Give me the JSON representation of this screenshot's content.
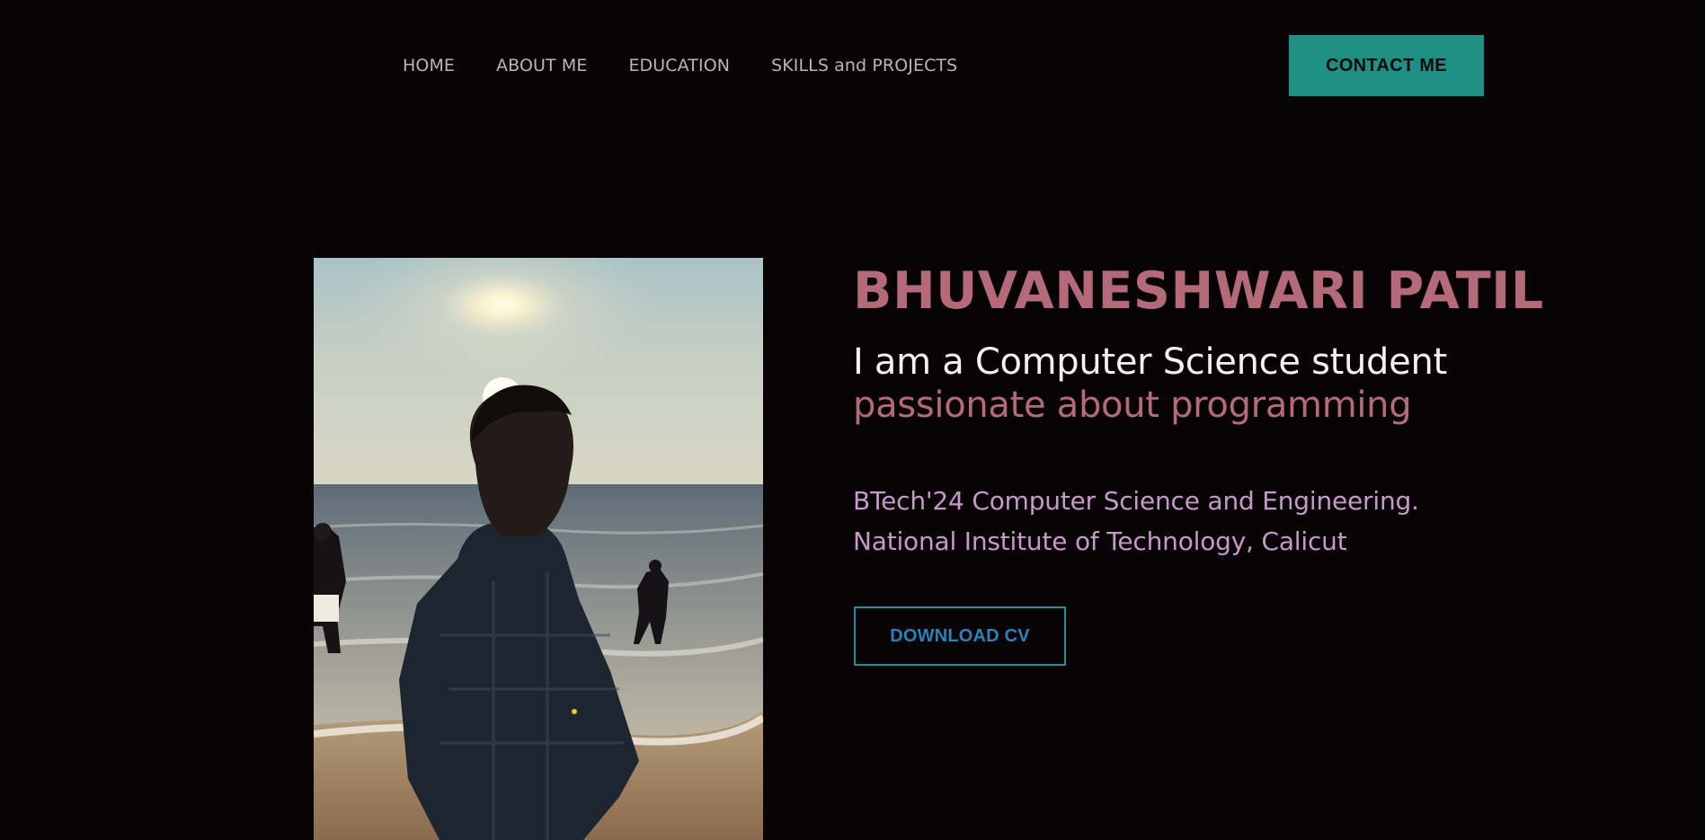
{
  "nav": {
    "items": [
      {
        "label": "HOME"
      },
      {
        "label": "ABOUT ME"
      },
      {
        "label": "EDUCATION"
      },
      {
        "label": "SKILLS and PROJECTS"
      }
    ],
    "contact_label": "CONTACT ME"
  },
  "hero": {
    "name": "BHUVANESHWARI PATIL",
    "tagline_line1": "I am a Computer Science student",
    "tagline_line2": "passionate about programming",
    "education_line1": "BTech'24 Computer Science and Engineering.",
    "education_line2": "National Institute of Technology, Calicut",
    "download_label": "DOWNLOAD CV"
  },
  "colors": {
    "background": "#080305",
    "accent_rose": "#b46a79",
    "accent_teal": "#1f8f84",
    "education_text": "#c59ac9"
  }
}
